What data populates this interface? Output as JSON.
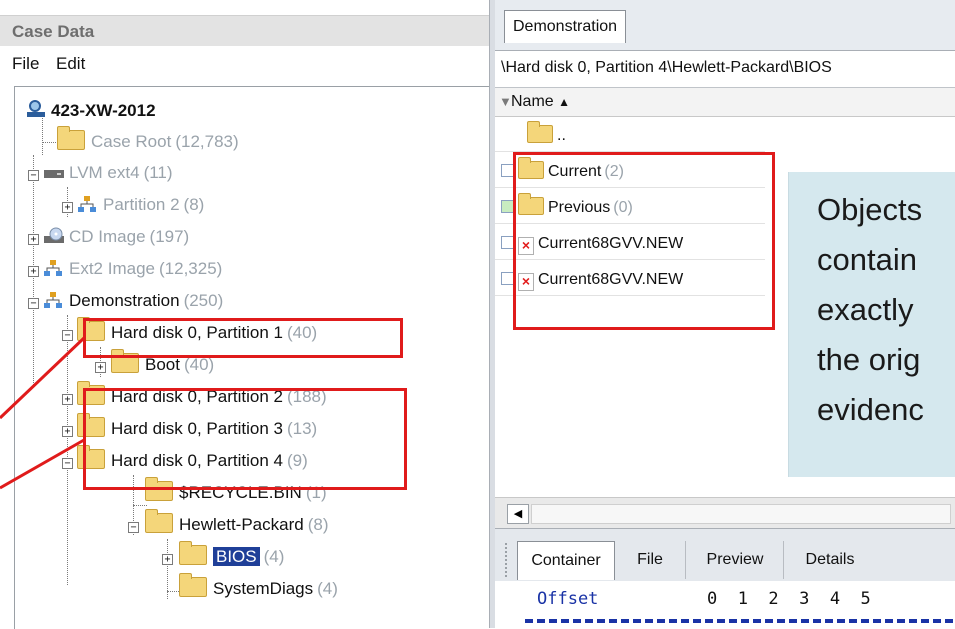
{
  "left_pane": {
    "title": "Case Data",
    "menu": {
      "file": "File",
      "edit": "Edit"
    },
    "tree": [
      {
        "label": "423-XW-2012",
        "count": ""
      },
      {
        "label": "Case Root",
        "count": "(12,783)"
      },
      {
        "label": "LVM ext4",
        "count": "(11)"
      },
      {
        "label": "Partition 2",
        "count": "(8)"
      },
      {
        "label": "CD Image",
        "count": "(197)"
      },
      {
        "label": "Ext2 Image",
        "count": "(12,325)"
      },
      {
        "label": "Demonstration",
        "count": "(250)"
      },
      {
        "label": "Hard disk 0, Partition 1",
        "count": "(40)"
      },
      {
        "label": "Boot",
        "count": "(40)"
      },
      {
        "label": "Hard disk 0, Partition 2",
        "count": "(188)"
      },
      {
        "label": "Hard disk 0, Partition 3",
        "count": "(13)"
      },
      {
        "label": "Hard disk 0, Partition 4",
        "count": "(9)"
      },
      {
        "label": "$RECYCLE.BIN",
        "count": "(1)"
      },
      {
        "label": "Hewlett-Packard",
        "count": "(8)"
      },
      {
        "label": "BIOS",
        "count": "(4)"
      },
      {
        "label": "SystemDiags",
        "count": "(4)"
      }
    ]
  },
  "right_pane": {
    "tab": "Demonstration",
    "path": "\\Hard disk 0, Partition 4\\Hewlett-Packard\\BIOS",
    "column_name": "Name",
    "up_label": "..",
    "rows": [
      {
        "label": "Current",
        "count": "(2)",
        "icon": "folder-icon"
      },
      {
        "label": "Previous",
        "count": "(0)",
        "icon": "folder-icon"
      },
      {
        "label": "Current68GVV.NEW",
        "count": "",
        "icon": "deleted-file-icon"
      },
      {
        "label": "Current68GVV.NEW",
        "count": "",
        "icon": "deleted-file-icon"
      }
    ],
    "bottom_tabs": [
      "Container",
      "File",
      "Preview",
      "Details"
    ],
    "hex": {
      "offset_label": "Offset",
      "columns": "0  1  2  3  4  5"
    }
  },
  "callout": {
    "lines": [
      "Objects",
      "contain",
      "exactly",
      "the orig",
      "evidenc"
    ]
  },
  "colors": {
    "annotation_red": "#e01b1b",
    "selection_blue": "#1f3f98",
    "callout_bg": "#d5e8ee"
  }
}
